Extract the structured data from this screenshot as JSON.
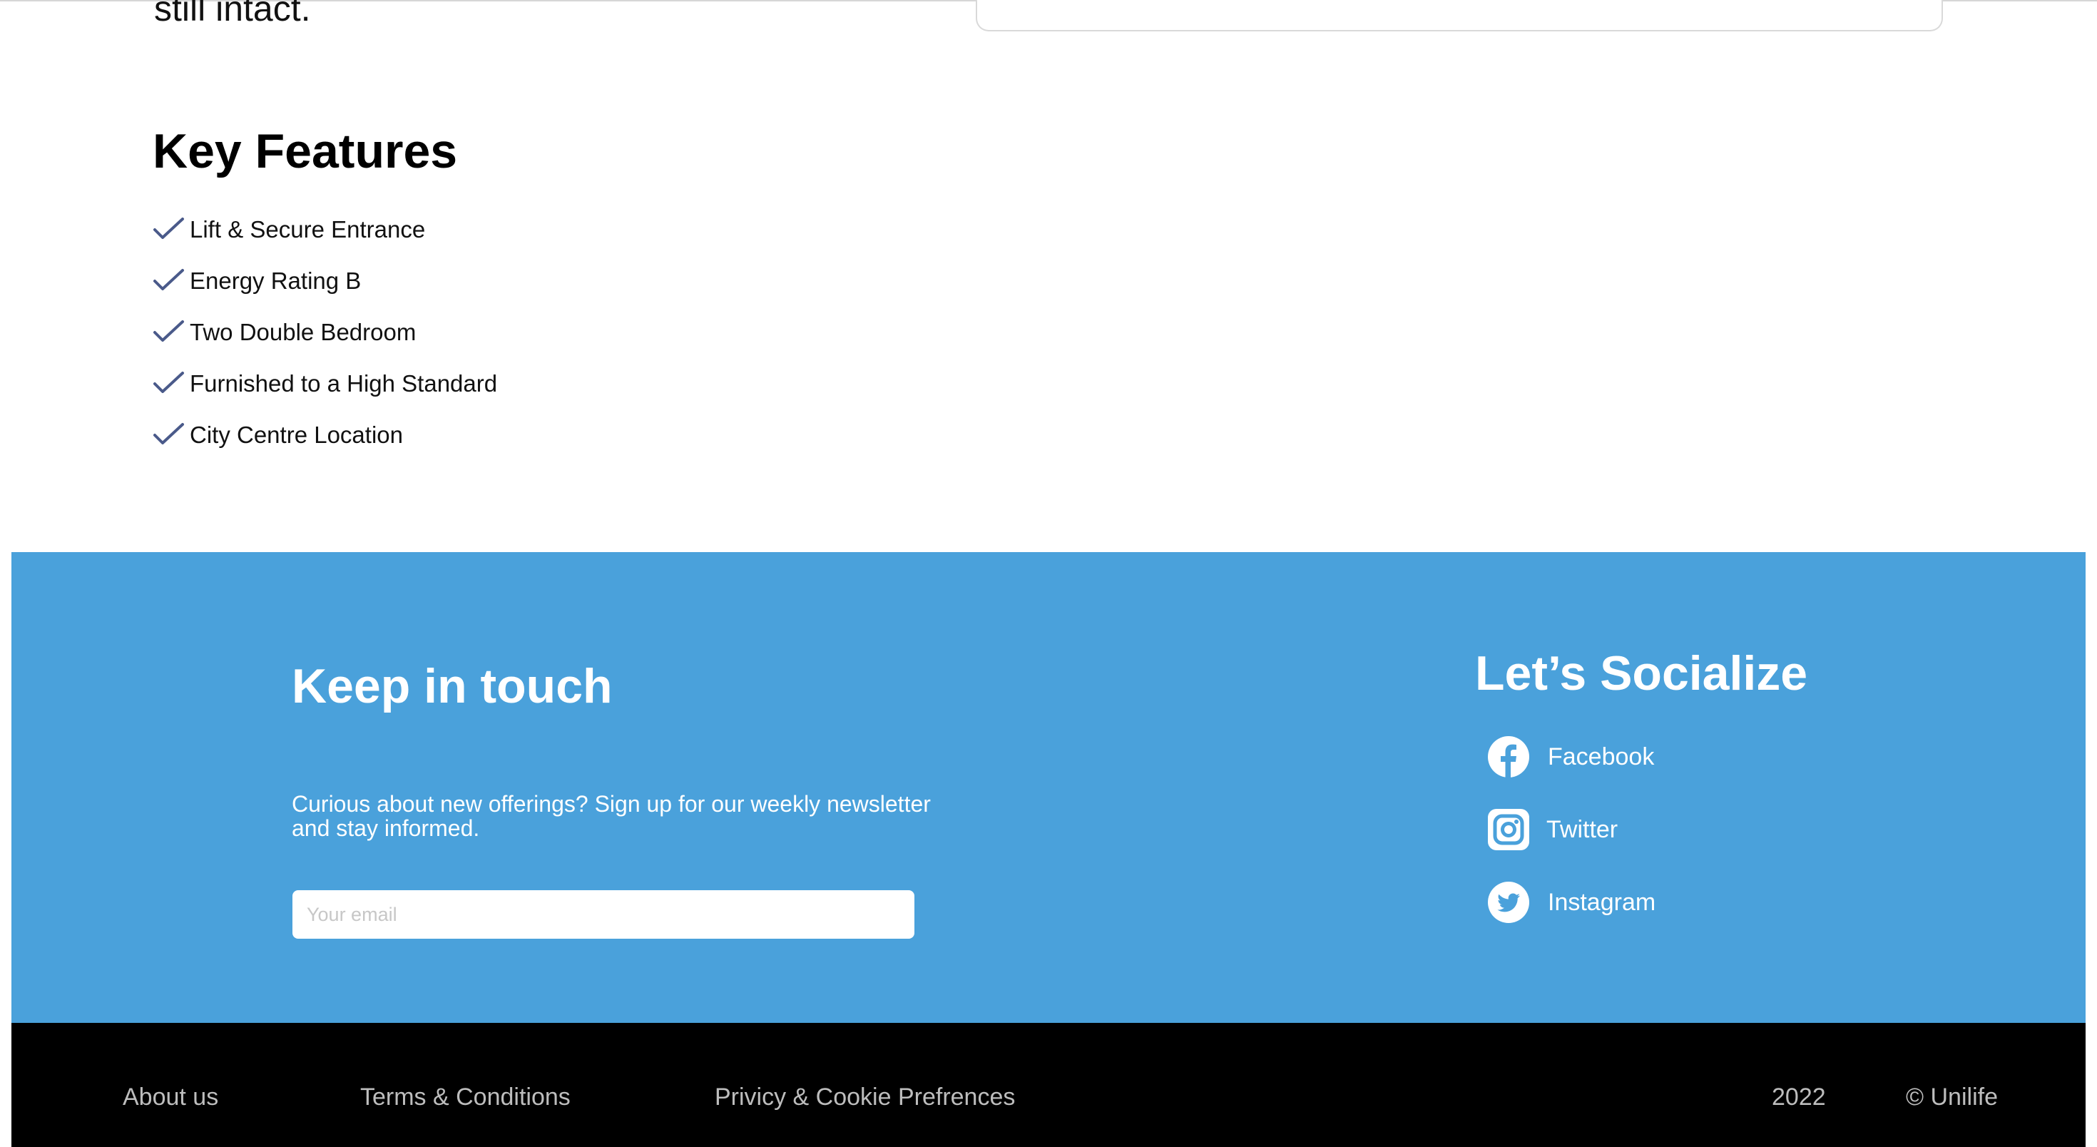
{
  "intro": {
    "tail_text": "still intact."
  },
  "features": {
    "title": "Key Features",
    "items": [
      "Lift & Secure Entrance",
      "Energy Rating B",
      "Two Double Bedroom",
      "Furnished to a High Standard",
      "City Centre Location"
    ]
  },
  "newsletter": {
    "title": "Keep in touch",
    "description": "Curious about new offerings? Sign up for our weekly newsletter and stay informed.",
    "email_placeholder": "Your email"
  },
  "social": {
    "title": "Let’s Socialize",
    "links": [
      {
        "label": "Facebook",
        "icon": "facebook-icon"
      },
      {
        "label": "Twitter",
        "icon": "instagram-icon"
      },
      {
        "label": "Instagram",
        "icon": "twitter-icon"
      }
    ]
  },
  "footer": {
    "about": "About us",
    "terms": "Terms & Conditions",
    "privacy": "Privicy & Cookie Prefrences",
    "year": "2022",
    "copyright": "© Unilife"
  },
  "colors": {
    "accent_blue": "#4aa1db",
    "check_color": "#4a5a8a",
    "footer_bg": "#000000",
    "footer_text": "#bdbdbd"
  }
}
